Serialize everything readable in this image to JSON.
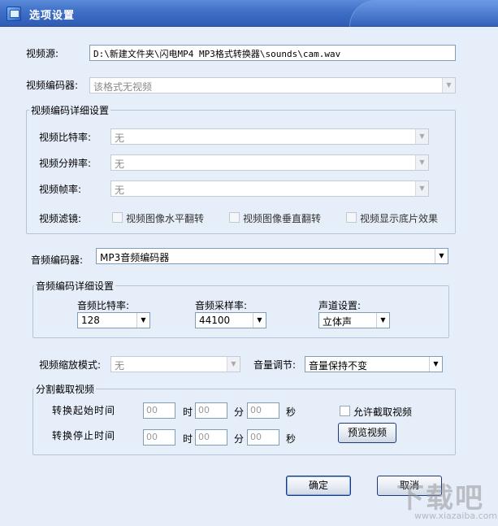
{
  "window": {
    "title": "选项设置"
  },
  "video_source": {
    "label": "视频源:",
    "value": "D:\\新建文件夹\\闪电MP4 MP3格式转换器\\sounds\\cam.wav"
  },
  "video_encoder": {
    "label": "视频编码器:",
    "value": "该格式无视频"
  },
  "video_details": {
    "title": "视频编码详细设置",
    "bitrate": {
      "label": "视频比特率:",
      "value": "无"
    },
    "resolution": {
      "label": "视频分辨率:",
      "value": "无"
    },
    "framerate": {
      "label": "视频帧率:",
      "value": "无"
    },
    "filter": {
      "label": "视频滤镜:",
      "options": [
        {
          "label": "视频图像水平翻转",
          "checked": false
        },
        {
          "label": "视频图像垂直翻转",
          "checked": false
        },
        {
          "label": "视频显示底片效果",
          "checked": false
        }
      ]
    }
  },
  "audio_encoder": {
    "label": "音频编码器:",
    "value": "MP3音频编码器"
  },
  "audio_details": {
    "title": "音频编码详细设置",
    "bitrate": {
      "label": "音频比特率:",
      "value": "128"
    },
    "samplerate": {
      "label": "音频采样率:",
      "value": "44100"
    },
    "channel": {
      "label": "声道设置:",
      "value": "立体声"
    }
  },
  "zoom_mode": {
    "label": "视频缩放模式:",
    "value": "无"
  },
  "volume": {
    "label": "音量调节:",
    "value": "音量保持不变"
  },
  "split": {
    "title": "分割截取视频",
    "start": {
      "label": "转换起始时间",
      "h": "00",
      "m": "00",
      "s": "00"
    },
    "end": {
      "label": "转换停止时间",
      "h": "00",
      "m": "00",
      "s": "00"
    },
    "unit_h": "时",
    "unit_m": "分",
    "unit_s": "秒",
    "allow_label": "允许截取视频",
    "allow_checked": false,
    "preview_button": "预览视频"
  },
  "buttons": {
    "ok": "确定",
    "cancel": "取消"
  },
  "watermark": {
    "text": "下载吧",
    "url": "www.xiazaiba.com"
  }
}
